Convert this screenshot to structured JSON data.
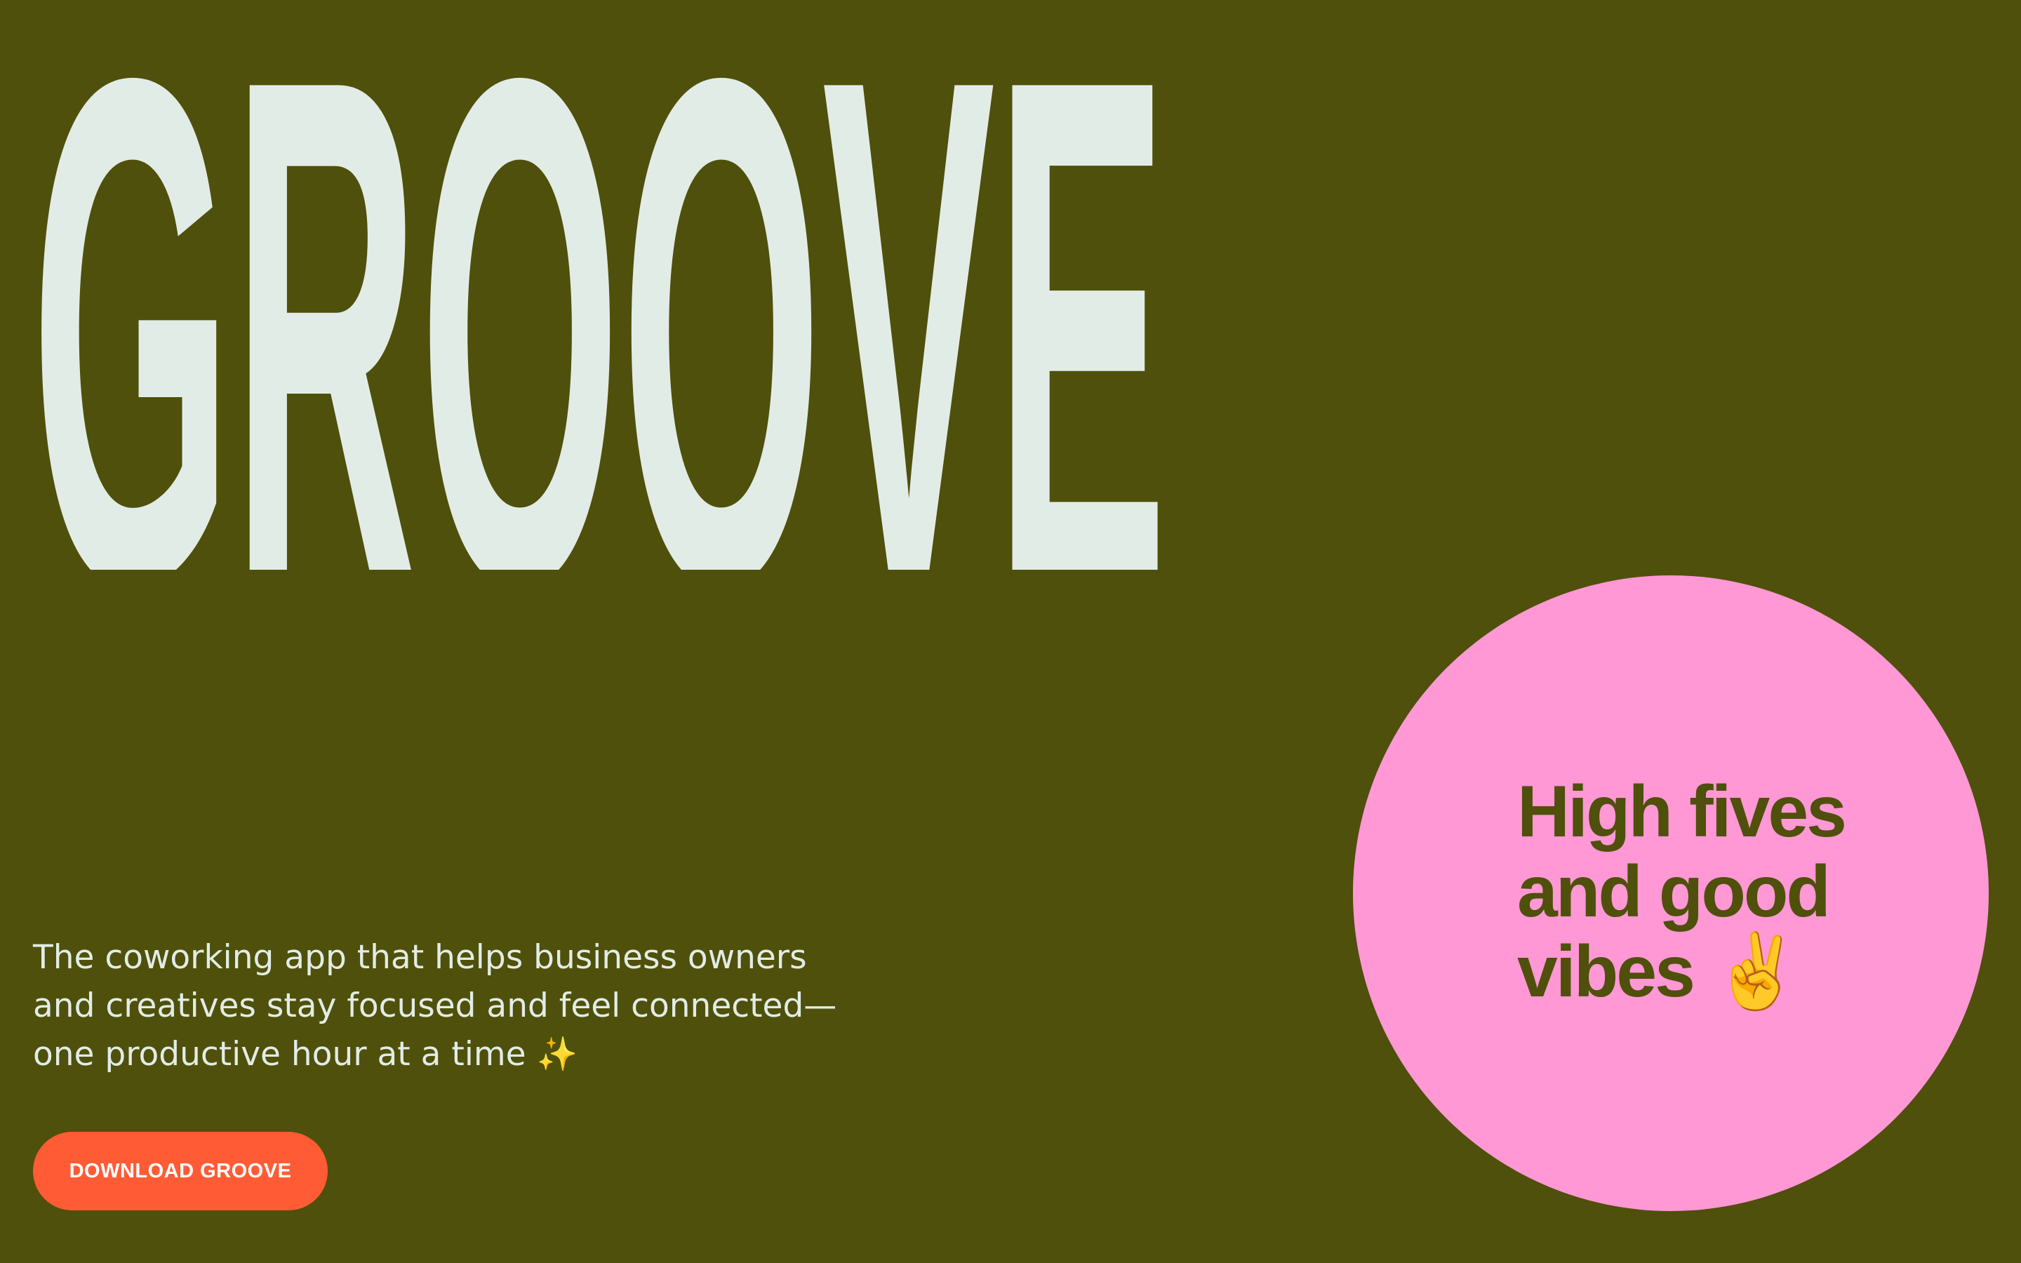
{
  "hero": {
    "wordmark": "GROOVE",
    "tagline_lines": [
      "The coworking app that helps business owners",
      "and creatives stay focused and feel connected—",
      "one productive hour at a time ✨"
    ],
    "cta_label": "DOWNLOAD GROOVE"
  },
  "badge": {
    "lines": [
      "High fives",
      "and good",
      "vibes ✌️"
    ]
  },
  "colors": {
    "background": "#4f500b",
    "wordmark": "#e2ece6",
    "cta": "#ff5c35",
    "badge": "#ff98d4"
  }
}
